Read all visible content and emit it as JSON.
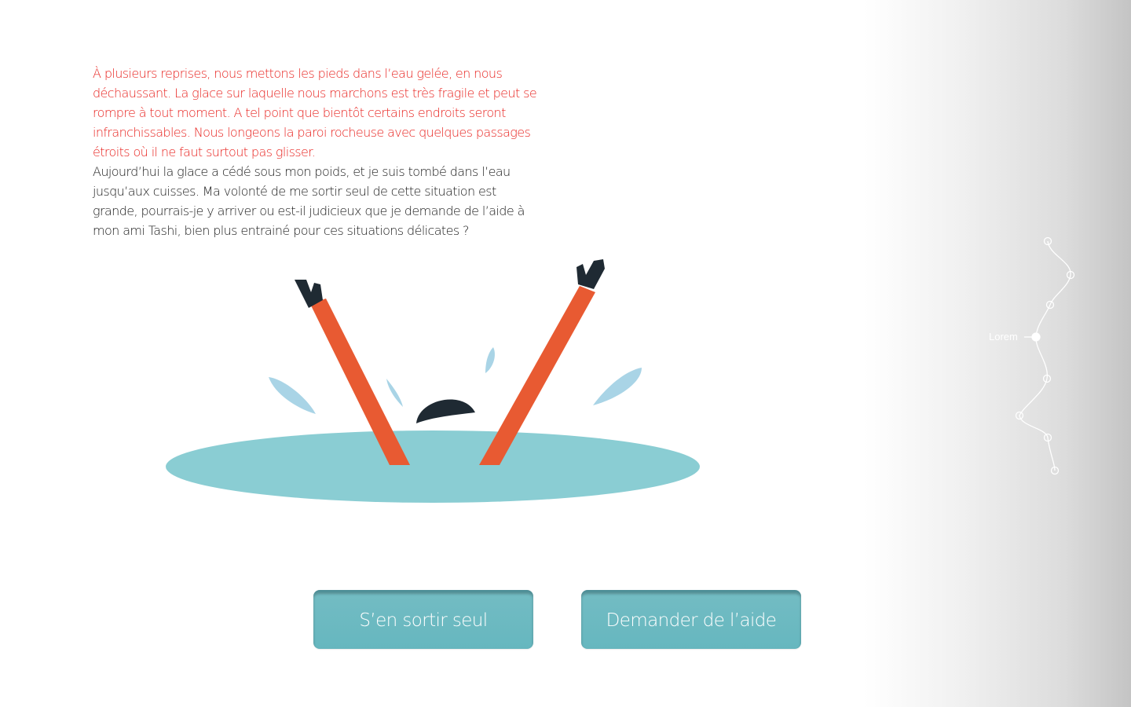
{
  "story": {
    "intro": "À plusieurs reprises, nous mettons les pieds dans l’eau gelée, en nous déchaussant. La glace sur laquelle nous marchons est très fragile et peut se rompre à tout moment. A tel point que bientôt certains endroits seront infranchissables. Nous longeons la paroi rocheuse avec quelques passages étroits où il ne faut surtout pas glisser.",
    "dilemma": "Aujourd’hui la glace a cédé sous mon poids, et je suis tombé dans l’eau jusqu’aux cuisses. Ma volonté de me sortir seul de cette situation est grande, pourrais-je y arriver ou est-il judicieux que je demande de l’aide à mon ami Tashi, bien plus entrainé pour ces situations délicates ?"
  },
  "illustration": {
    "subject": "person-fallen-through-ice"
  },
  "choices": {
    "alone_label": "S’en sortir seul",
    "help_label": "Demander de l’aide"
  },
  "progress": {
    "current_label": "Lorem",
    "steps_total": 8,
    "current_step": 4
  },
  "colors": {
    "accent_red": "#e8231f",
    "water": "#8acdd3",
    "legs": "#e85a32",
    "boots": "#1f2a33",
    "button": "#6ab8c0"
  }
}
